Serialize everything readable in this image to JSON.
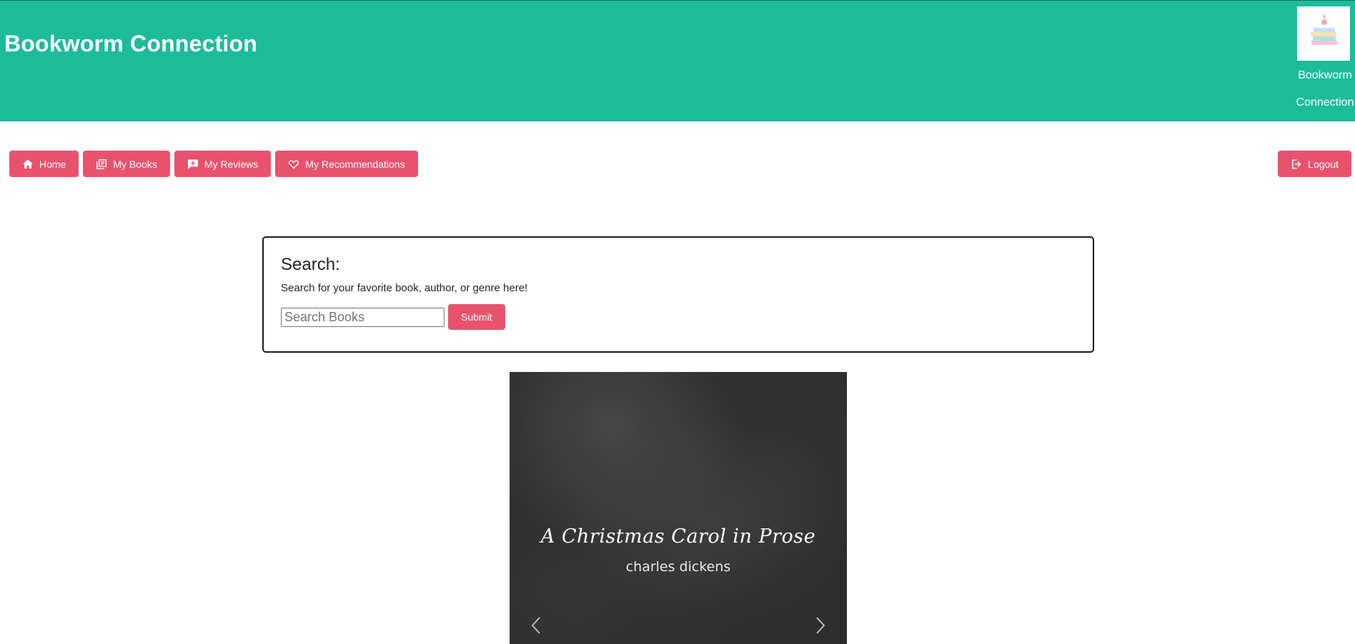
{
  "header": {
    "title": "Bookworm Connection",
    "brand_line1": "Bookworm",
    "brand_line2": "Connection",
    "logo_icon": "book-stack-logo"
  },
  "nav": {
    "items": [
      {
        "label": "Home",
        "icon": "home-icon"
      },
      {
        "label": "My Books",
        "icon": "books-icon"
      },
      {
        "label": "My Reviews",
        "icon": "review-icon"
      },
      {
        "label": "My Recommendations",
        "icon": "heart-icon"
      }
    ],
    "logout_label": "Logout",
    "logout_icon": "logout-icon"
  },
  "search": {
    "title": "Search:",
    "description": "Search for your favorite book, author, or genre here!",
    "placeholder": "Search Books",
    "value": "",
    "submit_label": "Submit"
  },
  "carousel": {
    "cover_title": "A Christmas Carol in Prose",
    "cover_author": "charles dickens",
    "prev_icon": "chevron-left-icon",
    "next_icon": "chevron-right-icon"
  },
  "colors": {
    "header_bg": "#1cbc9b",
    "button_bg": "#e9526d",
    "button_text": "#ffffff"
  }
}
